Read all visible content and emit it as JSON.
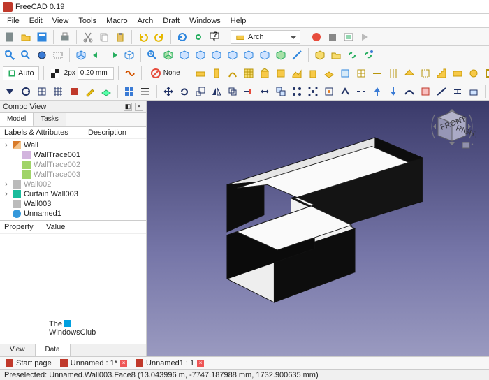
{
  "title": "FreeCAD 0.19",
  "menu": [
    "File",
    "Edit",
    "View",
    "Tools",
    "Macro",
    "Arch",
    "Draft",
    "Windows",
    "Help"
  ],
  "workbench": {
    "selected": "Arch"
  },
  "auto_button": "Auto",
  "line_px": "2px",
  "line_mm": "0.20 mm",
  "none_btn": "None",
  "combo_view": {
    "title": "Combo View",
    "tabs": [
      "Model",
      "Tasks"
    ],
    "active_tab": "Model",
    "columns": [
      "Labels & Attributes",
      "Description"
    ],
    "tree": [
      {
        "label": "Wall",
        "expandable": true,
        "icon": "wall-ico"
      },
      {
        "label": "WallTrace001",
        "child": true,
        "icon": "linked-ico"
      },
      {
        "label": "WallTrace002",
        "child": true,
        "icon": "trace-ico",
        "muted": true
      },
      {
        "label": "WallTrace003",
        "child": true,
        "icon": "trace-ico",
        "muted": true
      },
      {
        "label": "Wall002",
        "expandable": true,
        "icon": "grey-ico",
        "muted": true
      },
      {
        "label": "Curtain Wall003",
        "expandable": true,
        "icon": "curtain-ico"
      },
      {
        "label": "Wall003",
        "icon": "grey-ico"
      },
      {
        "label": "Unnamed1",
        "icon": "orb-ico"
      }
    ]
  },
  "property_panel": {
    "columns": [
      "Property",
      "Value"
    ]
  },
  "bottom_tabs": [
    "View",
    "Data"
  ],
  "bottom_active": "Data",
  "watermark": {
    "l1": "The",
    "l2": "WindowsClub"
  },
  "doc_tabs": [
    "Start page",
    "Unnamed : 1*",
    "Unnamed1 : 1"
  ],
  "status": "Preselected: Unnamed.Wall003.Face8 (13.043996 m, -7747.187988 mm, 1732.900635 mm)"
}
